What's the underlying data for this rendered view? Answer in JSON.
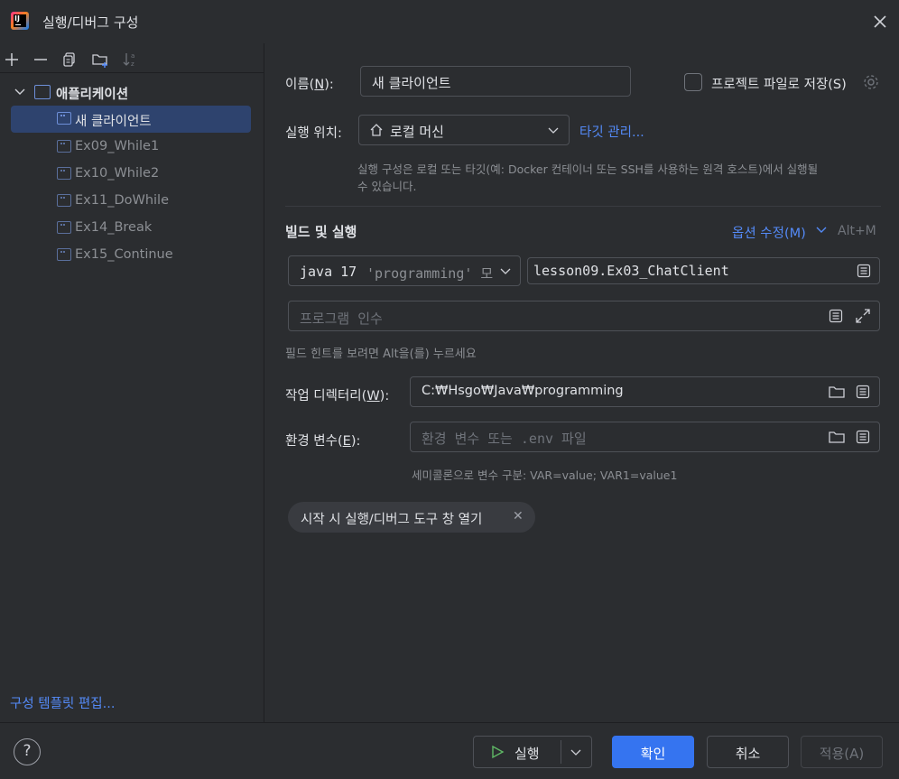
{
  "window": {
    "title": "실행/디버그 구성"
  },
  "sidebar": {
    "group_label": "애플리케이션",
    "items": [
      {
        "label": "새 클라이언트"
      },
      {
        "label": "Ex09_While1"
      },
      {
        "label": "Ex10_While2"
      },
      {
        "label": "Ex11_DoWhile"
      },
      {
        "label": "Ex14_Break"
      },
      {
        "label": "Ex15_Continue"
      }
    ],
    "edit_templates_link": "구성 템플릿 편집..."
  },
  "form": {
    "name_label": "이름(",
    "name_mnemonic": "N",
    "name_label_end": "):",
    "name_value": "새 클라이언트",
    "store_as_project_file": "프로젝트 파일로 저장(S)",
    "run_on_label": "실행 위치:",
    "run_on_value": "로컬 머신",
    "manage_targets_link": "타깃 관리...",
    "run_on_hint_line1": "실행 구성은 로컬 또는 타깃(예: Docker 컨테이너 또는 SSH를 사용하는 원격 호스트)에서 실행될",
    "run_on_hint_line2": "수 있습니다.",
    "build_run_header": "빌드 및 실행",
    "modify_options": "옵션 수정(M)",
    "modify_options_shortcut": "Alt+M",
    "jdk_main": "java 17",
    "jdk_module": "'programming' 모",
    "main_class": "lesson09.Ex03_ChatClient",
    "program_args_placeholder": "프로그램 인수",
    "field_hint": "필드 힌트를 보려면 Alt을(를) 누르세요",
    "working_dir_label": "작업 디렉터리(",
    "working_dir_mnemonic": "W",
    "working_dir_label_end": "):",
    "working_dir_value": "C:₩Hsgo₩Java₩programming",
    "env_label": "환경 변수(",
    "env_mnemonic": "E",
    "env_label_end": "):",
    "env_placeholder": "환경 변수 또는 .env 파일",
    "env_hint": "세미콜론으로 변수 구분: VAR=value; VAR1=value1",
    "chip_label": "시작 시 실행/디버그 도구 창 열기"
  },
  "footer": {
    "help": "?",
    "run_button": "실행",
    "ok_button": "확인",
    "cancel_button": "취소",
    "apply_button": "적용(A)"
  },
  "colors": {
    "background": "#2b2d30",
    "accent": "#3574f0",
    "link": "#548af7",
    "selection": "#2e436e"
  }
}
